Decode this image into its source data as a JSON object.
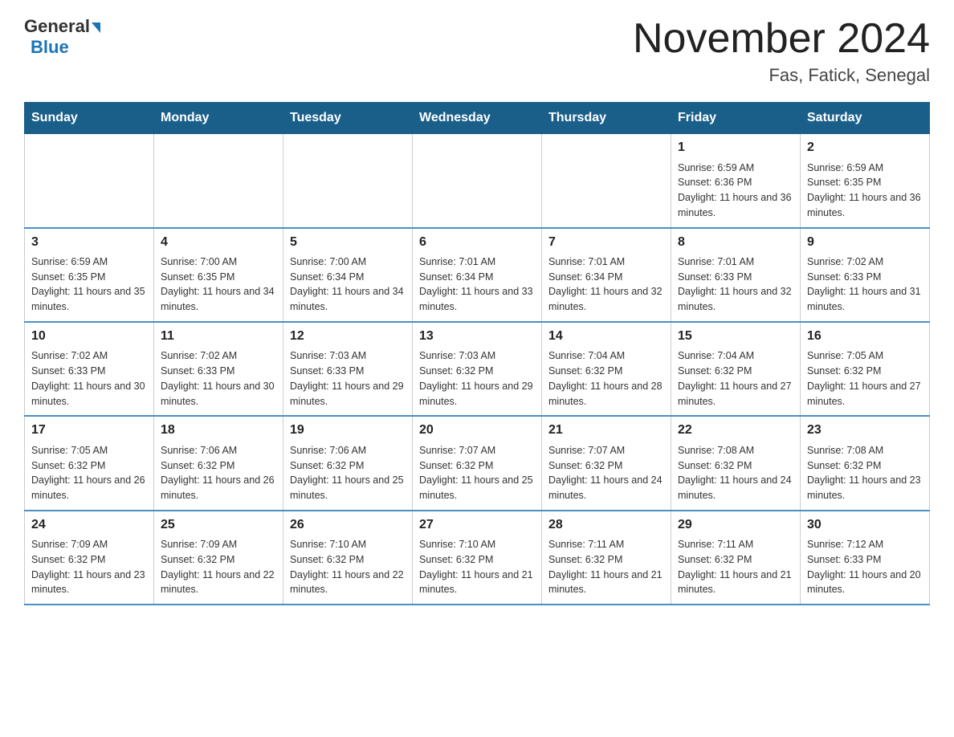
{
  "logo": {
    "general": "General",
    "arrow": "▶",
    "blue": "Blue"
  },
  "title": "November 2024",
  "subtitle": "Fas, Fatick, Senegal",
  "days_of_week": [
    "Sunday",
    "Monday",
    "Tuesday",
    "Wednesday",
    "Thursday",
    "Friday",
    "Saturday"
  ],
  "weeks": [
    [
      {
        "day": "",
        "info": ""
      },
      {
        "day": "",
        "info": ""
      },
      {
        "day": "",
        "info": ""
      },
      {
        "day": "",
        "info": ""
      },
      {
        "day": "",
        "info": ""
      },
      {
        "day": "1",
        "info": "Sunrise: 6:59 AM\nSunset: 6:36 PM\nDaylight: 11 hours and 36 minutes."
      },
      {
        "day": "2",
        "info": "Sunrise: 6:59 AM\nSunset: 6:35 PM\nDaylight: 11 hours and 36 minutes."
      }
    ],
    [
      {
        "day": "3",
        "info": "Sunrise: 6:59 AM\nSunset: 6:35 PM\nDaylight: 11 hours and 35 minutes."
      },
      {
        "day": "4",
        "info": "Sunrise: 7:00 AM\nSunset: 6:35 PM\nDaylight: 11 hours and 34 minutes."
      },
      {
        "day": "5",
        "info": "Sunrise: 7:00 AM\nSunset: 6:34 PM\nDaylight: 11 hours and 34 minutes."
      },
      {
        "day": "6",
        "info": "Sunrise: 7:01 AM\nSunset: 6:34 PM\nDaylight: 11 hours and 33 minutes."
      },
      {
        "day": "7",
        "info": "Sunrise: 7:01 AM\nSunset: 6:34 PM\nDaylight: 11 hours and 32 minutes."
      },
      {
        "day": "8",
        "info": "Sunrise: 7:01 AM\nSunset: 6:33 PM\nDaylight: 11 hours and 32 minutes."
      },
      {
        "day": "9",
        "info": "Sunrise: 7:02 AM\nSunset: 6:33 PM\nDaylight: 11 hours and 31 minutes."
      }
    ],
    [
      {
        "day": "10",
        "info": "Sunrise: 7:02 AM\nSunset: 6:33 PM\nDaylight: 11 hours and 30 minutes."
      },
      {
        "day": "11",
        "info": "Sunrise: 7:02 AM\nSunset: 6:33 PM\nDaylight: 11 hours and 30 minutes."
      },
      {
        "day": "12",
        "info": "Sunrise: 7:03 AM\nSunset: 6:33 PM\nDaylight: 11 hours and 29 minutes."
      },
      {
        "day": "13",
        "info": "Sunrise: 7:03 AM\nSunset: 6:32 PM\nDaylight: 11 hours and 29 minutes."
      },
      {
        "day": "14",
        "info": "Sunrise: 7:04 AM\nSunset: 6:32 PM\nDaylight: 11 hours and 28 minutes."
      },
      {
        "day": "15",
        "info": "Sunrise: 7:04 AM\nSunset: 6:32 PM\nDaylight: 11 hours and 27 minutes."
      },
      {
        "day": "16",
        "info": "Sunrise: 7:05 AM\nSunset: 6:32 PM\nDaylight: 11 hours and 27 minutes."
      }
    ],
    [
      {
        "day": "17",
        "info": "Sunrise: 7:05 AM\nSunset: 6:32 PM\nDaylight: 11 hours and 26 minutes."
      },
      {
        "day": "18",
        "info": "Sunrise: 7:06 AM\nSunset: 6:32 PM\nDaylight: 11 hours and 26 minutes."
      },
      {
        "day": "19",
        "info": "Sunrise: 7:06 AM\nSunset: 6:32 PM\nDaylight: 11 hours and 25 minutes."
      },
      {
        "day": "20",
        "info": "Sunrise: 7:07 AM\nSunset: 6:32 PM\nDaylight: 11 hours and 25 minutes."
      },
      {
        "day": "21",
        "info": "Sunrise: 7:07 AM\nSunset: 6:32 PM\nDaylight: 11 hours and 24 minutes."
      },
      {
        "day": "22",
        "info": "Sunrise: 7:08 AM\nSunset: 6:32 PM\nDaylight: 11 hours and 24 minutes."
      },
      {
        "day": "23",
        "info": "Sunrise: 7:08 AM\nSunset: 6:32 PM\nDaylight: 11 hours and 23 minutes."
      }
    ],
    [
      {
        "day": "24",
        "info": "Sunrise: 7:09 AM\nSunset: 6:32 PM\nDaylight: 11 hours and 23 minutes."
      },
      {
        "day": "25",
        "info": "Sunrise: 7:09 AM\nSunset: 6:32 PM\nDaylight: 11 hours and 22 minutes."
      },
      {
        "day": "26",
        "info": "Sunrise: 7:10 AM\nSunset: 6:32 PM\nDaylight: 11 hours and 22 minutes."
      },
      {
        "day": "27",
        "info": "Sunrise: 7:10 AM\nSunset: 6:32 PM\nDaylight: 11 hours and 21 minutes."
      },
      {
        "day": "28",
        "info": "Sunrise: 7:11 AM\nSunset: 6:32 PM\nDaylight: 11 hours and 21 minutes."
      },
      {
        "day": "29",
        "info": "Sunrise: 7:11 AM\nSunset: 6:32 PM\nDaylight: 11 hours and 21 minutes."
      },
      {
        "day": "30",
        "info": "Sunrise: 7:12 AM\nSunset: 6:33 PM\nDaylight: 11 hours and 20 minutes."
      }
    ]
  ]
}
